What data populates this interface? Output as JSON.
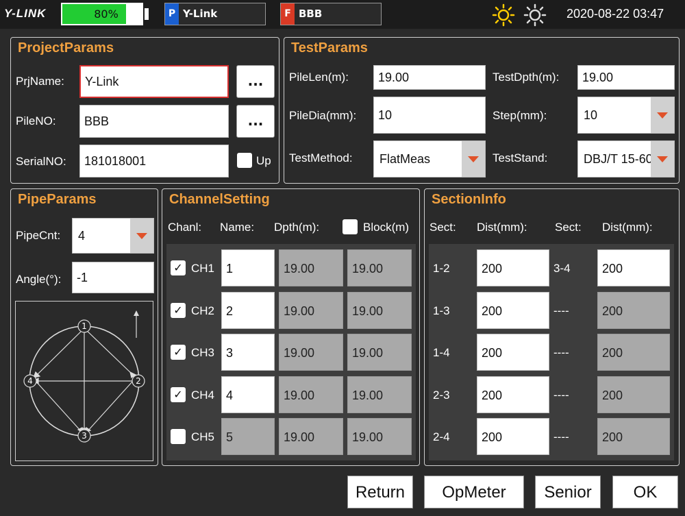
{
  "topbar": {
    "logo": "Y-LINK",
    "battery": {
      "label": "80%",
      "level": 0.8
    },
    "project_chip": {
      "letter": "P",
      "label": "Y-Link",
      "color": "#1a5fd0"
    },
    "file_chip": {
      "letter": "F",
      "label": "BBB",
      "color": "#d93a25"
    },
    "datetime": "2020-08-22 03:47"
  },
  "project_params": {
    "title": "ProjectParams",
    "prj_name_label": "PrjName:",
    "prj_name_value": "Y-Link",
    "pile_no_label": "PileNO:",
    "pile_no_value": "BBB",
    "serial_no_label": "SerialNO:",
    "serial_no_value": "181018001",
    "browse_label": "...",
    "up_label": "Up"
  },
  "test_params": {
    "title": "TestParams",
    "pile_len_label": "PileLen(m):",
    "pile_len_value": "19.00",
    "test_depth_label": "TestDpth(m):",
    "test_depth_value": "19.00",
    "pile_dia_label": "PileDia(mm):",
    "pile_dia_value": "10",
    "step_label": "Step(mm):",
    "step_value": "10",
    "test_method_label": "TestMethod:",
    "test_method_value": "FlatMeas",
    "test_stand_label": "TestStand:",
    "test_stand_value": "DBJ/T 15-60"
  },
  "pipe_params": {
    "title": "PipeParams",
    "pipe_cnt_label": "PipeCnt:",
    "pipe_cnt_value": "4",
    "angle_label": "Angle(°):",
    "angle_value": "-1",
    "diagram_nodes": [
      "1",
      "2",
      "3",
      "4"
    ]
  },
  "channel_setting": {
    "title": "ChannelSetting",
    "headers": {
      "chanl": "Chanl:",
      "name": "Name:",
      "depth": "Dpth(m):",
      "block": "Block(m)"
    },
    "rows": [
      {
        "ch": "CH1",
        "name": "1",
        "depth": "19.00",
        "block": "19.00",
        "checked": true
      },
      {
        "ch": "CH2",
        "name": "2",
        "depth": "19.00",
        "block": "19.00",
        "checked": true
      },
      {
        "ch": "CH3",
        "name": "3",
        "depth": "19.00",
        "block": "19.00",
        "checked": true
      },
      {
        "ch": "CH4",
        "name": "4",
        "depth": "19.00",
        "block": "19.00",
        "checked": true
      },
      {
        "ch": "CH5",
        "name": "5",
        "depth": "19.00",
        "block": "19.00",
        "checked": false
      }
    ]
  },
  "section_info": {
    "title": "SectionInfo",
    "headers": {
      "sect1": "Sect:",
      "dist1": "Dist(mm):",
      "sect2": "Sect:",
      "dist2": "Dist(mm):"
    },
    "rows": [
      {
        "sect1": "1-2",
        "dist1": "200",
        "sect2": "3-4",
        "dist2": "200"
      },
      {
        "sect1": "1-3",
        "dist1": "200",
        "sect2": "----",
        "dist2": "200"
      },
      {
        "sect1": "1-4",
        "dist1": "200",
        "sect2": "----",
        "dist2": "200"
      },
      {
        "sect1": "2-3",
        "dist1": "200",
        "sect2": "----",
        "dist2": "200"
      },
      {
        "sect1": "2-4",
        "dist1": "200",
        "sect2": "----",
        "dist2": "200"
      }
    ]
  },
  "buttons": {
    "return": "Return",
    "opmeter": "OpMeter",
    "senior": "Senior",
    "ok": "OK"
  }
}
